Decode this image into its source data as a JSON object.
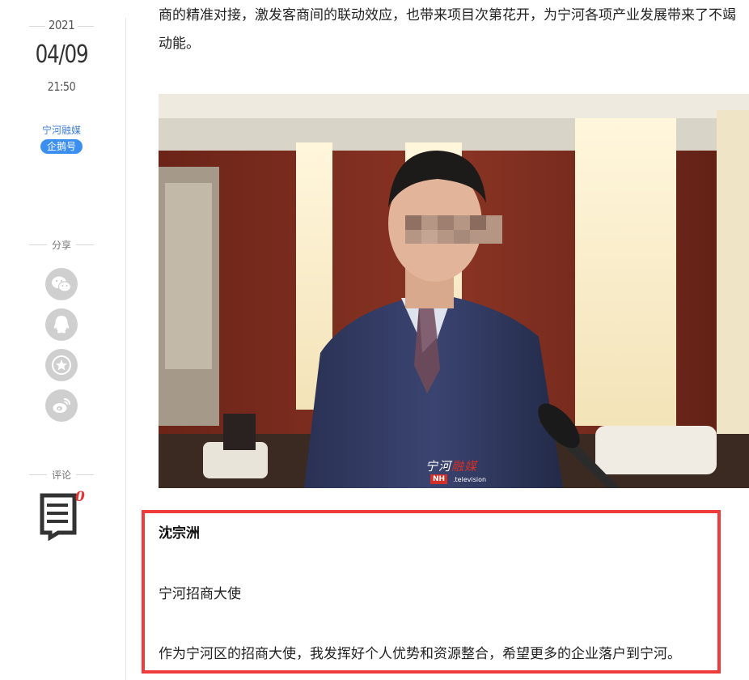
{
  "sidebar": {
    "year": "2021",
    "date": "04/09",
    "time": "21:50",
    "author": "宁河融媒",
    "badge": "企鹅号",
    "share_label": "分享",
    "share_buttons": [
      {
        "icon": "wechat-icon"
      },
      {
        "icon": "qq-icon"
      },
      {
        "icon": "star-favorite-icon"
      },
      {
        "icon": "weibo-icon"
      }
    ],
    "comment_label": "评论",
    "comment_count": "0",
    "colors": {
      "author": "#3e7fd6",
      "badge_bg": "#3b8ff0",
      "comment_count": "#e63232"
    }
  },
  "article": {
    "paragraph_1": "商的精准对接，激发客商间的联动效应，也带来项目次第花开，为宁河各项产业发展带来了不竭动能。",
    "image": {
      "description_icon": "photo-man-in-suit-interview",
      "watermark": {
        "brand_a": "宁河",
        "brand_b": "融媒",
        "tag": "NH",
        "sub": ".television"
      }
    },
    "highlight": {
      "name": "沈宗洲",
      "role": "宁河招商大使",
      "quote": "作为宁河区的招商大使，我发挥好个人优势和资源整合，希望更多的企业落户到宁河。",
      "border_color": "#ee3b3b"
    }
  }
}
